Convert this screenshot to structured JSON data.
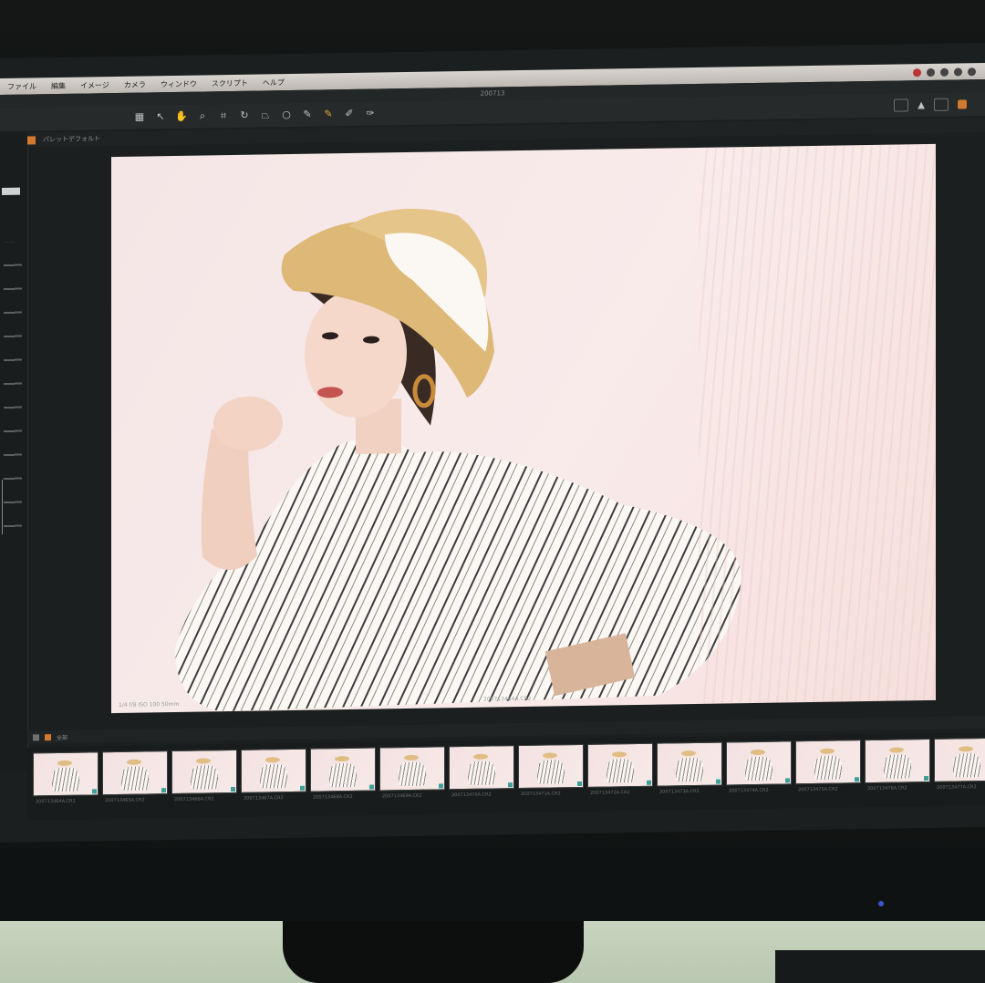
{
  "menubar": {
    "items": [
      "ファイル",
      "編集",
      "イメージ",
      "カメラ",
      "ウィンドウ",
      "スクリプト",
      "ヘルプ"
    ]
  },
  "window": {
    "title": "200713"
  },
  "tabstrip": {
    "label": "パレットデフォルト"
  },
  "viewer": {
    "meta": "1/4 f/8 ISO 100 50mm",
    "filename": "200713464A.CR2"
  },
  "filmstrip": {
    "header_label": "全部",
    "thumbnails": [
      {
        "label": "200713464A.CR2"
      },
      {
        "label": "200713465A.CR2"
      },
      {
        "label": "200713466A.CR2"
      },
      {
        "label": "200713467A.CR2"
      },
      {
        "label": "200713468A.CR2"
      },
      {
        "label": "200713469A.CR2"
      },
      {
        "label": "200713470A.CR2"
      },
      {
        "label": "200713471A.CR2"
      },
      {
        "label": "200713472A.CR2"
      },
      {
        "label": "200713473A.CR2"
      },
      {
        "label": "200713474A.CR2"
      },
      {
        "label": "200713475A.CR2"
      },
      {
        "label": "200713476A.CR2"
      },
      {
        "label": "200713477A.CR2"
      }
    ]
  },
  "colors": {
    "accent": "#d2782f",
    "panel": "#1b1f1f",
    "photo_bg": "#f4e6e6"
  },
  "icons": [
    "grid-icon",
    "pointer-icon",
    "pan-icon",
    "zoom-icon",
    "crop-icon",
    "rotate-icon",
    "keystone-icon",
    "spot-icon",
    "brush-icon",
    "eraser-icon",
    "gradient-icon",
    "picker-icon"
  ]
}
